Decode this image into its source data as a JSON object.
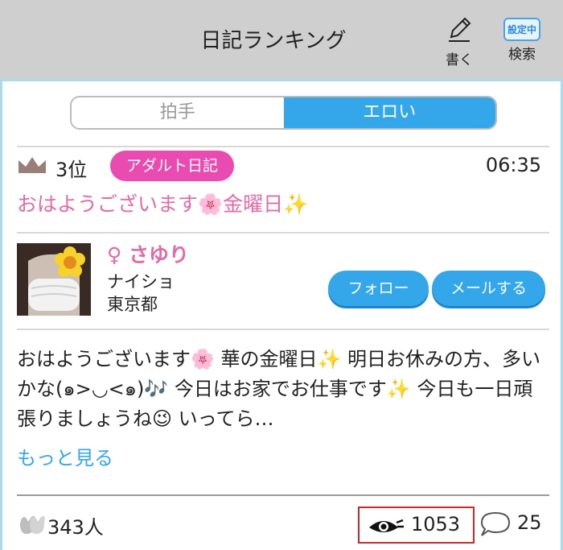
{
  "header": {
    "title": "日記ランキング",
    "write_label": "書く",
    "search_label": "検索",
    "search_badge": "設定中"
  },
  "tabs": [
    {
      "label": "拍手",
      "selected": false
    },
    {
      "label": "エロい",
      "selected": true
    }
  ],
  "post": {
    "rank": "3位",
    "category": "アダルト日記",
    "time": "06:35",
    "title": "おはようございます🌸金曜日✨",
    "author": {
      "gender": "♀",
      "name": "さゆり",
      "job": "ナイショ",
      "area": "東京都"
    },
    "follow_label": "フォロー",
    "mail_label": "メールする",
    "body": "おはようございます🌸 華の金曜日✨ 明日お休みの方、多いかな(๑>◡<๑)🎶 今日はお家でお仕事です✨ 今日も一日頑張りましょうね😉 いってら…",
    "more_label": "もっと見る",
    "claps": "343人",
    "views": "1053",
    "comments": "25"
  },
  "colors": {
    "accent_blue": "#33a7ea",
    "pink_text": "#e46aa6",
    "tag_pink": "#e94bb0",
    "header_gray": "#cfcfcf"
  }
}
